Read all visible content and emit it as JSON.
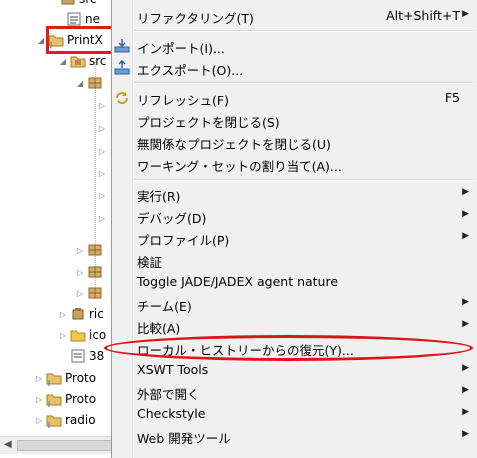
{
  "tree": {
    "items": [
      {
        "label": "src",
        "icon": "package-icon"
      },
      {
        "label": "ne",
        "icon": "text-file-icon"
      },
      {
        "label": "PrintX",
        "icon": "java-project-icon",
        "expanded": true
      },
      {
        "label": "src",
        "icon": "source-folder-icon",
        "expanded": true
      },
      {
        "label": "",
        "icon": "package-icon"
      },
      {
        "label": "",
        "icon": "package-icon"
      },
      {
        "label": "",
        "icon": "package-icon"
      },
      {
        "label": "ric",
        "icon": "jar-icon"
      },
      {
        "label": "ico",
        "icon": "folder-icon"
      },
      {
        "label": "38",
        "icon": "text-file-icon"
      },
      {
        "label": "Proto",
        "icon": "java-project-icon"
      },
      {
        "label": "Proto",
        "icon": "java-project-icon"
      },
      {
        "label": "radio",
        "icon": "java-project-icon"
      }
    ]
  },
  "menu": {
    "items": [
      {
        "label": "リファクタリング(T)",
        "accel": "Alt+Shift+T",
        "submenu": true
      },
      {
        "label": "インポート(I)...",
        "icon": "import-icon"
      },
      {
        "label": "エクスポート(O)...",
        "icon": "export-icon"
      },
      {
        "label": "リフレッシュ(F)",
        "accel": "F5",
        "icon": "refresh-icon"
      },
      {
        "label": "プロジェクトを閉じる(S)"
      },
      {
        "label": "無関係なプロジェクトを閉じる(U)"
      },
      {
        "label": "ワーキング・セットの割り当て(A)..."
      },
      {
        "label": "実行(R)",
        "submenu": true
      },
      {
        "label": "デバッグ(D)",
        "submenu": true
      },
      {
        "label": "プロファイル(P)",
        "submenu": true
      },
      {
        "label": "検証"
      },
      {
        "label": "Toggle JADE/JADEX agent nature"
      },
      {
        "label": "チーム(E)",
        "submenu": true
      },
      {
        "label": "比較(A)",
        "submenu": true
      },
      {
        "label": "ローカル・ヒストリーからの復元(Y)..."
      },
      {
        "label": "XSWT Tools",
        "submenu": true
      },
      {
        "label": "外部で開く",
        "submenu": true
      },
      {
        "label": "Checkstyle",
        "submenu": true
      },
      {
        "label": "Web 開発ツール",
        "submenu": true
      }
    ]
  },
  "colors": {
    "highlight_red": "#e01b1b",
    "menu_bg": "#f0f0f0"
  }
}
